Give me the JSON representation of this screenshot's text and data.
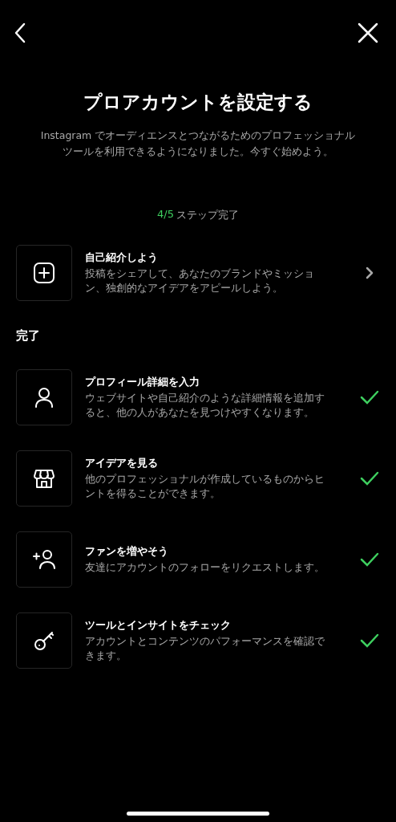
{
  "title": "プロアカウントを設定する",
  "subtitle": "Instagram でオーディエンスとつながるためのプロフェッショナルツールを利用できるようになりました。今すぐ始めよう。",
  "progress": {
    "count": "4/5",
    "label": "ステップ完了"
  },
  "pending": [
    {
      "kind": "plus",
      "title": "自己紹介しよう",
      "description": "投稿をシェアして、あなたのブランドやミッション、独創的なアイデアをアピールしよう。",
      "done": false
    }
  ],
  "completed_heading": "完了",
  "completed": [
    {
      "kind": "person",
      "title": "プロフィール詳細を入力",
      "description": "ウェブサイトや自己紹介のような詳細情報を追加すると、他の人があなたを見つけやすくなります。",
      "done": true
    },
    {
      "kind": "shop",
      "title": "アイデアを見る",
      "description": "他のプロフェッショナルが作成しているものからヒントを得ることができます。",
      "done": true
    },
    {
      "kind": "add_person",
      "title": "ファンを増やそう",
      "description": "友達にアカウントのフォローをリクエストします。",
      "done": true
    },
    {
      "kind": "key",
      "title": "ツールとインサイトをチェック",
      "description": "アカウントとコンテンツのパフォーマンスを確認できます。",
      "done": true
    }
  ]
}
